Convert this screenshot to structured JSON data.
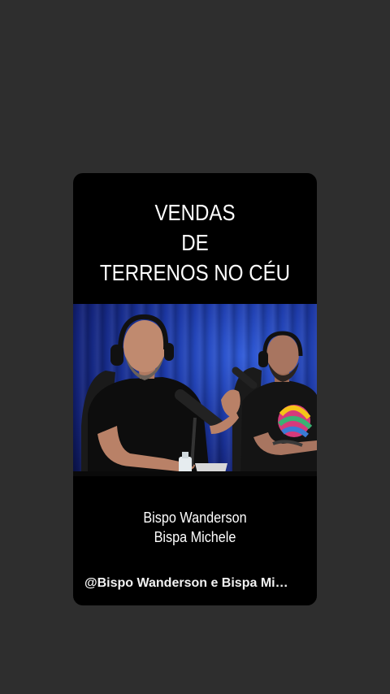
{
  "headline": {
    "line1": "VENDAS",
    "line2": "DE",
    "line3": "TERRENOS NO CÉU"
  },
  "captions": {
    "line1": "Bispo Wanderson",
    "line2": "Bispa Michele"
  },
  "credit": "@Bispo Wanderson e Bispa Mi…",
  "colors": {
    "page_background": "#2e2e2e",
    "card_background": "#000000",
    "curtain_blue": "#1d3aa8"
  }
}
